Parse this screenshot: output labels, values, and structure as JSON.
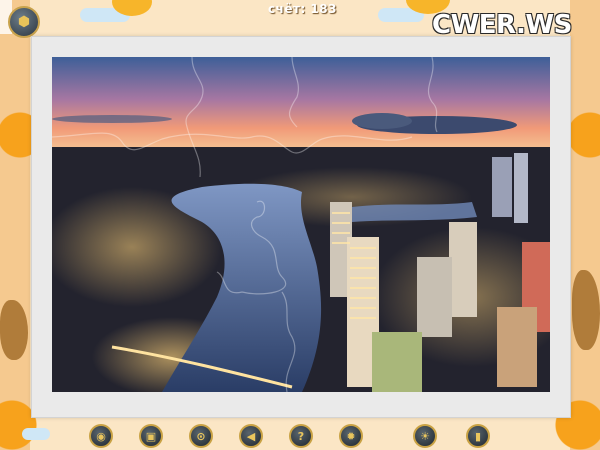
{
  "header": {
    "score_label": "счёт: 183",
    "watermark": "CWER.WS"
  },
  "toolbar": {
    "icons": [
      "eye-icon",
      "image-icon",
      "magnifier-icon",
      "back-arrow-icon",
      "help-icon",
      "settings-gear-icon",
      "sun-gear-icon",
      "exit-door-icon"
    ]
  },
  "colors": {
    "button_ring": "#c9a244",
    "button_fill": "#1f272e",
    "board": "#eaeaea"
  }
}
